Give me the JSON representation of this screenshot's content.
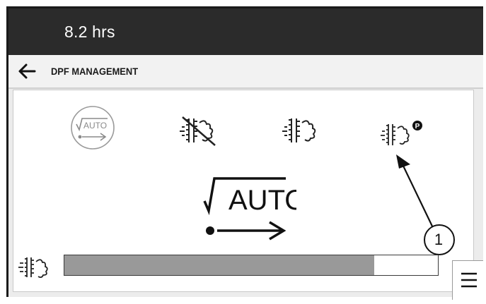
{
  "header": {
    "hours": "8.2 hrs"
  },
  "titlebar": {
    "title": "DPF MANAGEMENT"
  },
  "modes": [
    {
      "name": "auto",
      "label": "AUTO",
      "icon": "auto-regen-icon"
    },
    {
      "name": "inhibit",
      "icon": "regen-inhibit-icon"
    },
    {
      "name": "request",
      "icon": "regen-request-icon"
    },
    {
      "name": "parked",
      "badge": "P",
      "icon": "parked-regen-icon"
    }
  ],
  "current_mode": {
    "label": "AUTO",
    "icon": "auto-regen-large-icon"
  },
  "soot_level": {
    "fill_fraction": 0.83
  },
  "callout": {
    "label": "1"
  },
  "menu": {
    "icon": "hamburger-menu-icon"
  }
}
